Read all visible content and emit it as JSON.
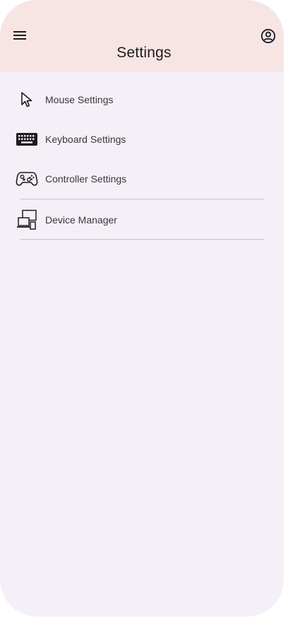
{
  "appbar": {
    "title": "Settings",
    "menu_icon": "hamburger-menu-icon",
    "account_icon": "account-circle-icon"
  },
  "settings_list": [
    {
      "label": "Mouse Settings",
      "icon": "mouse-pointer-icon"
    },
    {
      "label": "Keyboard Settings",
      "icon": "keyboard-icon"
    },
    {
      "label": "Controller Settings",
      "icon": "gamepad-icon"
    },
    {
      "label": "Device Manager",
      "icon": "devices-icon"
    }
  ],
  "colors": {
    "appbar_bg": "#f6e5e3",
    "surface_bg": "#f5f0f7",
    "text_primary": "#1d1b20",
    "divider": "#c9c4cc"
  }
}
